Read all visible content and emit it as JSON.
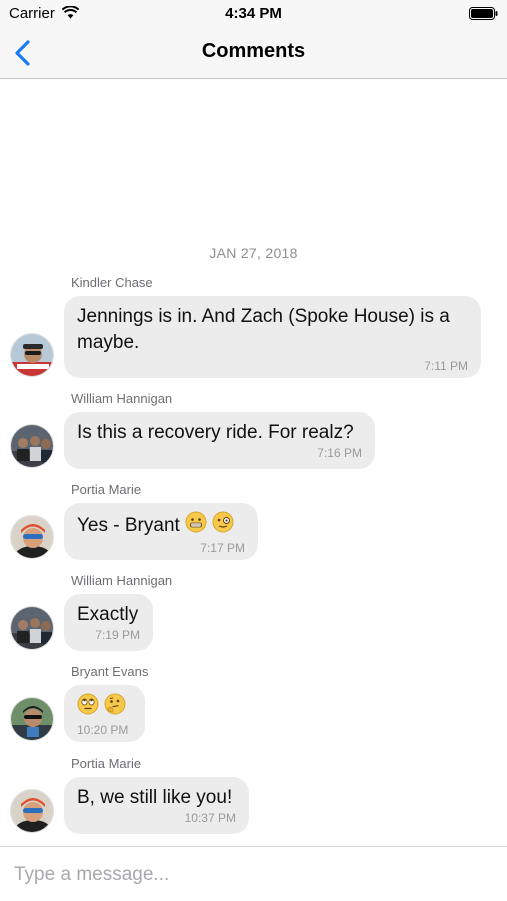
{
  "status_bar": {
    "carrier": "Carrier",
    "time": "4:34 PM"
  },
  "nav": {
    "title": "Comments",
    "back_icon": "chevron-left-icon"
  },
  "date_header": "JAN 27, 2018",
  "messages": [
    {
      "sender": "Kindler Chase",
      "text": "Jennings is in. And Zach (Spoke House) is a maybe.",
      "time": "7:11 PM",
      "avatar": "avatar-kindler-chase"
    },
    {
      "sender": "William Hannigan",
      "text": "Is this a recovery ride. For realz?",
      "time": "7:16 PM",
      "avatar": "avatar-william-hannigan"
    },
    {
      "sender": "Portia Marie",
      "text": "Yes - Bryant",
      "emojis": [
        "grimacing-face-emoji",
        "face-with-monocle-emoji"
      ],
      "time": "7:17 PM",
      "avatar": "avatar-portia-marie"
    },
    {
      "sender": "William Hannigan",
      "text": "Exactly",
      "time": "7:19 PM",
      "avatar": "avatar-william-hannigan"
    },
    {
      "sender": "Bryant Evans",
      "text": "",
      "emojis": [
        "rolling-eyes-emoji",
        "thinking-face-emoji"
      ],
      "time": "10:20 PM",
      "avatar": "avatar-bryant-evans"
    },
    {
      "sender": "Portia Marie",
      "text": "B, we still like you!",
      "time": "10:37 PM",
      "avatar": "avatar-portia-marie"
    }
  ],
  "composer": {
    "placeholder": "Type a message..."
  },
  "colors": {
    "accent": "#1a7cf5",
    "bubble": "#ececec",
    "timestamp": "#9a9a9a"
  }
}
